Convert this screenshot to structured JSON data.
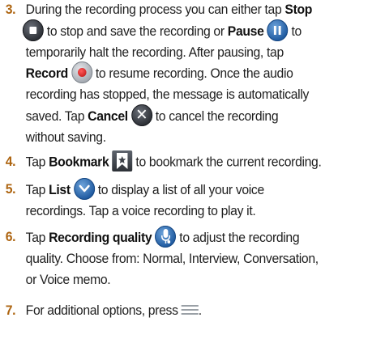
{
  "steps": [
    {
      "number": "3.",
      "l1_pre": "During the recording process you can either tap ",
      "l1_stop": "Stop",
      "l2_post": " to stop and save the recording or ",
      "l2_pause": "Pause",
      "l2_to": " to",
      "l3": "temporarily halt the recording. After pausing, tap",
      "l4_record": "Record",
      "l4_post": " to resume recording. Once the audio",
      "l5": "recording has stopped, the message is automatically",
      "l6_pre": "saved. Tap ",
      "l6_cancel": "Cancel",
      "l6_post": " to cancel the recording",
      "l7": "without saving."
    },
    {
      "number": "4.",
      "pre": "Tap ",
      "bold": "Bookmark",
      "post": " to bookmark the current recording."
    },
    {
      "number": "5.",
      "pre": "Tap ",
      "bold": "List",
      "post": " to display a list of all your voice",
      "l2": "recordings. Tap a voice recording to play it."
    },
    {
      "number": "6.",
      "pre": "Tap ",
      "bold": "Recording quality",
      "post": " to adjust the recording",
      "l2": "quality. Choose from: Normal, Interview, Conversation,",
      "l3": "or Voice memo."
    },
    {
      "number": "7.",
      "pre": "For additional options, press ",
      "post": "."
    }
  ],
  "icons": {
    "stop": "stop-icon",
    "pause": "pause-icon",
    "record": "record-icon",
    "cancel": "cancel-icon",
    "bookmark": "bookmark-icon",
    "list": "list-chevron-icon",
    "quality": "microphone-settings-icon",
    "menu": "menu-icon"
  },
  "colors": {
    "step_number": "#ad6410",
    "record": "#d21f1f",
    "pause": "#1f5aa0"
  }
}
